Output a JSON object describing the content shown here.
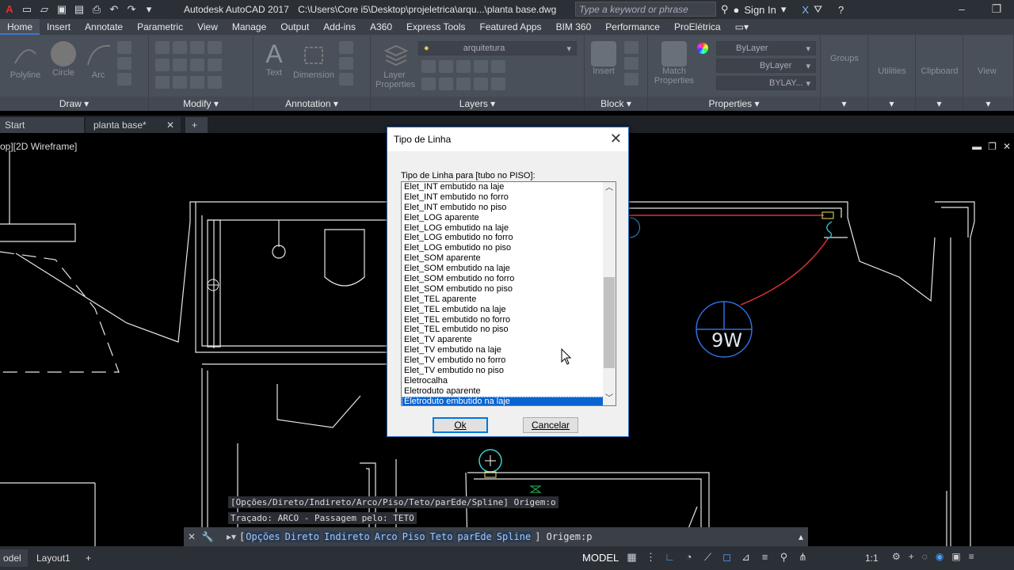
{
  "title_bar": {
    "app": "Autodesk AutoCAD 2017",
    "path": "C:\\Users\\Core i5\\Desktop\\projeletrica\\arqu...\\planta base.dwg",
    "search_placeholder": "Type a keyword or phrase",
    "sign_in": "Sign In"
  },
  "ribbon_tabs": [
    "Home",
    "Insert",
    "Annotate",
    "Parametric",
    "View",
    "Manage",
    "Output",
    "Add-ins",
    "A360",
    "Express Tools",
    "Featured Apps",
    "BIM 360",
    "Performance",
    "ProElétrica"
  ],
  "ribbon": {
    "draw": {
      "title": "Draw",
      "polyline": "Polyline",
      "circle": "Circle",
      "arc": "Arc"
    },
    "modify": {
      "title": "Modify"
    },
    "annotation": {
      "title": "Annotation",
      "text": "Text",
      "dimension": "Dimension"
    },
    "layers": {
      "title": "Layers",
      "layer_properties": "Layer Properties",
      "current_layer": "arquitetura"
    },
    "block": {
      "title": "Block",
      "insert": "Insert"
    },
    "properties": {
      "title": "Properties",
      "match": "Match Properties",
      "color": "ByLayer",
      "linetype": "ByLayer",
      "lineweight": "BYLAY..."
    },
    "groups": "Groups",
    "utilities": "Utilities",
    "clipboard": "Clipboard",
    "view": "View"
  },
  "doc_tabs": {
    "start": "Start",
    "current": "planta base*"
  },
  "viewport_label": "op][2D Wireframe]",
  "drawing": {
    "fixture_label": "9W"
  },
  "dialog": {
    "title": "Tipo de Linha",
    "label": "Tipo de Linha para [tubo no PISO]:",
    "items": [
      "Elet_INT embutido na laje",
      "Elet_INT embutido no forro",
      "Elet_INT embutido no piso",
      "Elet_LOG aparente",
      "Elet_LOG embutido na laje",
      "Elet_LOG embutido no forro",
      "Elet_LOG embutido no piso",
      "Elet_SOM aparente",
      "Elet_SOM embutido na laje",
      "Elet_SOM embutido no forro",
      "Elet_SOM embutido no piso",
      "Elet_TEL aparente",
      "Elet_TEL embutido na laje",
      "Elet_TEL embutido no forro",
      "Elet_TEL embutido no piso",
      "Elet_TV aparente",
      "Elet_TV embutido na laje",
      "Elet_TV embutido no forro",
      "Elet_TV embutido no piso",
      "Eletrocalha",
      "Eletroduto aparente",
      "Eletroduto embutido na laje"
    ],
    "selected": "Eletroduto embutido na laje",
    "ok": "Ok",
    "cancel": "Cancelar"
  },
  "command": {
    "history1": "[Opções/Direto/Indireto/Arco/Piso/Teto/parEde/Spline] Origem:o",
    "history2": "Traçado: ARCO  -  Passagem pelo: TETO",
    "prompt_prefix": "[",
    "options": [
      "Opções",
      "Direto",
      "Indireto",
      "Arco",
      "Piso",
      "Teto",
      "parEde",
      "Spline"
    ],
    "prompt_suffix": "] Origem:p"
  },
  "status": {
    "model_tab": "odel",
    "layout1": "Layout1",
    "model": "MODEL",
    "scale": "1:1"
  }
}
